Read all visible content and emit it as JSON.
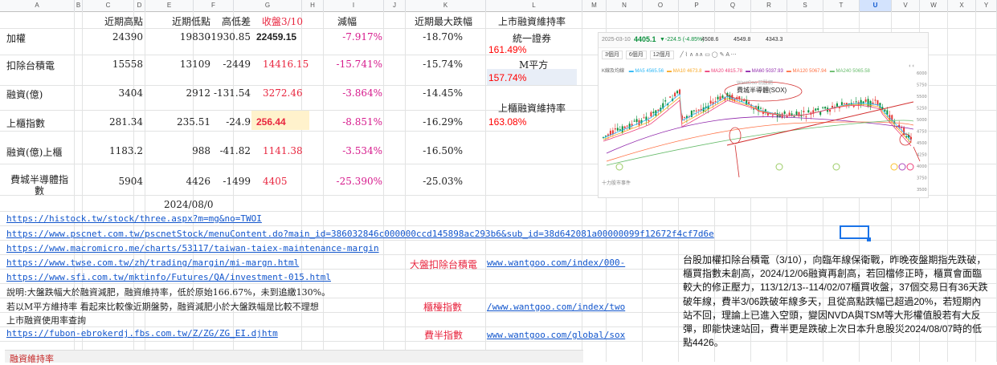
{
  "columns": [
    "A",
    "B",
    "C",
    "D",
    "E",
    "F",
    "G",
    "H",
    "I",
    "J",
    "K",
    "L",
    "M",
    "N",
    "O",
    "P",
    "Q",
    "R",
    "S",
    "T",
    "U",
    "V",
    "W",
    "X",
    "Y"
  ],
  "selected_column": "U",
  "header": {
    "c": "近期高點",
    "e": "近期低點",
    "f": "高低差",
    "g": "收盤3/10",
    "i": "減幅",
    "k": "近期最大跌幅",
    "l": "上市融資維持率"
  },
  "rows": [
    {
      "a": "加權",
      "c": "24390",
      "e": "19830",
      "f": "-1930.85",
      "g": "22459.15",
      "i": "-7.917%",
      "k": "-18.70%"
    },
    {
      "a": "扣除台積電",
      "c": "15558",
      "e": "13109",
      "f": "-2449",
      "g": "14416.15",
      "i": "-15.741%",
      "k": "-15.74%"
    },
    {
      "a": "融資(億)",
      "c": "3404",
      "e": "2912",
      "f": "-131.54",
      "g": "3272.46",
      "i": "-3.864%",
      "k": "-14.45%"
    },
    {
      "a": "上櫃指數",
      "c": "281.34",
      "e": "235.51",
      "f": "-24.9",
      "g": "256.44",
      "i": "-8.851%",
      "k": "-16.29%"
    },
    {
      "a": "融資(億)上櫃",
      "c": "1183.2",
      "e": "988",
      "f": "-41.82",
      "g": "1141.38",
      "i": "-3.534%",
      "k": "-16.50%"
    },
    {
      "a": "費城半導體指數",
      "c": "5904",
      "e": "4426",
      "f": "-1499",
      "g": "4405",
      "i": "-25.390%",
      "k": "-25.03%"
    }
  ],
  "date_cell": "2024/08/0",
  "margin": {
    "l1": "統一證券",
    "v1": "161.49%",
    "l2": "M平方",
    "v2": "157.74%",
    "l3": "上櫃融資維持率",
    "v3": "163.08%"
  },
  "links": [
    "https://histock.tw/stock/three.aspx?m=mg&no=TWOI",
    "https://www.pscnet.com.tw/pscnetStock/menuContent.do?main_id=386032846c000000ccd145898ac293b6&sub_id=38d642081a00000099f12672f4cf7d6e",
    "https://www.macromicro.me/charts/53117/taiwan-taiex-maintenance-margin",
    "https://www.twse.com.tw/zh/trading/margin/mi-margn.html",
    "https://www.sfi.com.tw/mktinfo/Futures/QA/investment-015.html"
  ],
  "notes": [
    "說明:大盤跌幅大於融資減肥，融資維持率，低於原始166.67%，未到追繳130%。",
    "若以M平方維持率 看起來比較像近期盤勢，融資減肥小於大盤跌幅是比較不理想",
    "上市融資使用率查詢"
  ],
  "link6": "https://fubon-ebrokerdj.fbs.com.tw/Z/ZG/ZG_EI.djhtm",
  "side_labels": {
    "s1": "大盤扣除台積電",
    "s2": "櫃檯指數",
    "s3": "費半指數"
  },
  "side_links": {
    "l1": "www.wantgoo.com/index/000-",
    "l2": "/www.wantgoo.com/index/two",
    "l3": "www.wantgoo.com/global/sox"
  },
  "paragraph": "台股加權扣除台積電（3/10），向臨年線保衛戰，昨晚夜盤期指先跌破，櫃買指數未創高，2024/12/06融資再創高，若回檔修正時，櫃買會面臨較大的修正壓力，113/12/13--114/02/07櫃買收盤，37個交易日有36天跌破年線，費半3/06跌破年線多天，且從高點跌幅已超過20%，若短期內站不回，理論上已進入空頭，變因NVDA與TSM等大形權值股若有大反彈，即能快速站回，費半更是跌破上次日本升息股災2024/08/07時的低點4426。",
  "bottom_tab": "融資維持率",
  "chart": {
    "date": "2025-03-10",
    "price": "4405.1",
    "change": "▼-224.5 (-4.85%)",
    "open": "4508.6",
    "high": "4549.8",
    "low": "4343.3",
    "periods": [
      "3個月",
      "6個月",
      "12個月"
    ],
    "ma_title": "K線及均線",
    "ma": [
      "MA5 4565.56",
      "MA10 4673.8",
      "MA20 4815.78",
      "MA60 5037.93",
      "MA120 5067.94",
      "MA240 5065.58"
    ],
    "ma_colors": [
      "#29b6f6",
      "#f9a825",
      "#ec407a",
      "#8e24aa",
      "#ff7043",
      "#66bb6a"
    ],
    "annotation": "費城半導體(SOX)",
    "watermark": "WantGoo 玩股網",
    "footer": "十力股市事件",
    "yticks": [
      "6000",
      "5750",
      "5500",
      "5250",
      "5000",
      "4750",
      "4500",
      "4250",
      "4000",
      "3750",
      "3500"
    ]
  }
}
